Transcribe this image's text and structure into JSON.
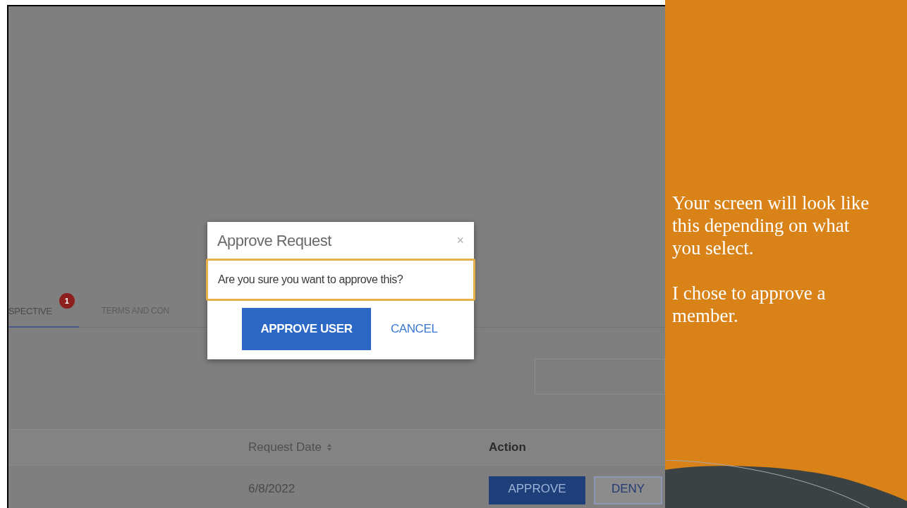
{
  "screenshot": {
    "tabs": [
      {
        "label": "SPECTIVE",
        "selected": true,
        "badge": "1"
      },
      {
        "label": "TERMS AND CON",
        "selected": false
      }
    ],
    "table": {
      "columns": [
        {
          "label": "Request Date",
          "sortable": true
        },
        {
          "label": "Action",
          "sortable": false
        }
      ],
      "rows": [
        {
          "request_date": "6/8/2022",
          "actions": [
            {
              "label": "APPROVE",
              "kind": "primary"
            },
            {
              "label": "DENY",
              "kind": "outline"
            }
          ]
        }
      ]
    },
    "dialog": {
      "title": "Approve Request",
      "close": "×",
      "message": "Are you sure you want to approve this?",
      "buttons": [
        {
          "label": "APPROVE USER",
          "kind": "primary"
        },
        {
          "label": "CANCEL",
          "kind": "link"
        }
      ]
    }
  },
  "notes": {
    "paragraphs": [
      "Your screen will look like this depending on what you select.",
      "I chose to approve a member."
    ]
  }
}
